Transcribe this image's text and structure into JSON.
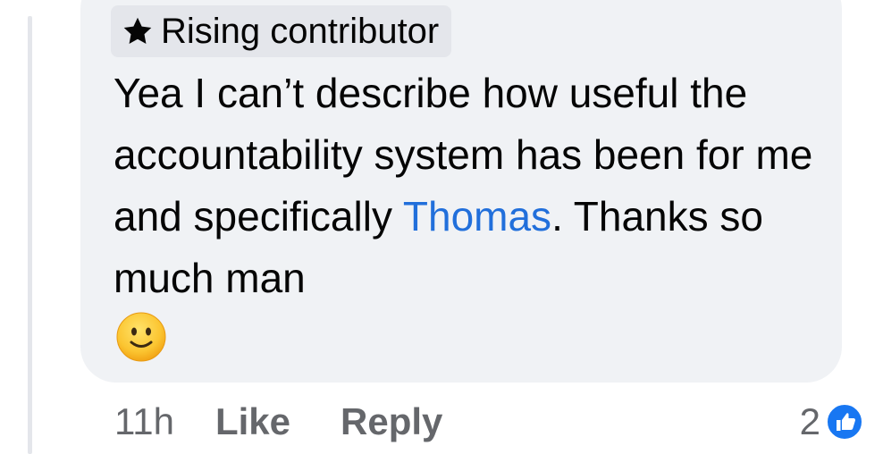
{
  "badge": {
    "icon": "star-icon",
    "label": "Rising contributor"
  },
  "comment": {
    "text_before": "Yea I can’t describe how useful the accountability system has been for me and specifically",
    "mention": "Thomas",
    "text_after": ". Thanks so much man",
    "emoji": "slightly-smiling-face-emoji"
  },
  "meta": {
    "timestamp": "11h",
    "like_label": "Like",
    "reply_label": "Reply"
  },
  "reactions": {
    "count": "2",
    "icon": "thumbs-up-icon",
    "accent_color": "#1877f2"
  },
  "colors": {
    "bubble": "#f0f2f5",
    "badge": "#e4e6eb",
    "mention": "#216fdb",
    "secondary_text": "#65676b"
  }
}
